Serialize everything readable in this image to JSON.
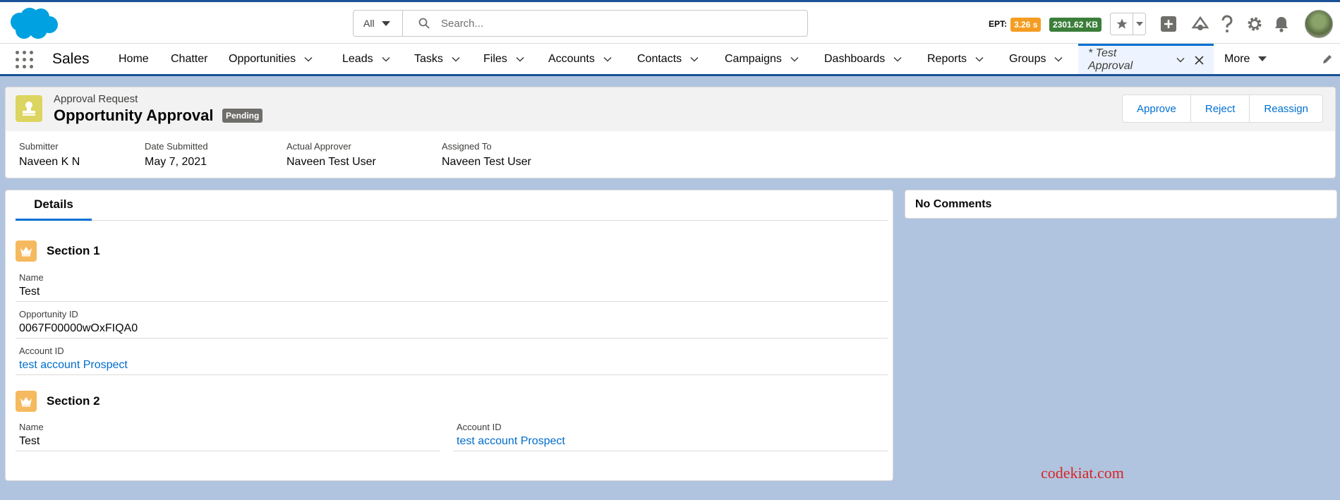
{
  "header": {
    "search": {
      "scope": "All",
      "placeholder": "Search..."
    },
    "ept": {
      "label": "EPT:",
      "time": "3.26 s",
      "size": "2301.62 KB"
    }
  },
  "nav": {
    "app_name": "Sales",
    "items": [
      {
        "label": "Home"
      },
      {
        "label": "Chatter"
      },
      {
        "label": "Opportunities"
      },
      {
        "label": "Leads"
      },
      {
        "label": "Tasks"
      },
      {
        "label": "Files"
      },
      {
        "label": "Accounts"
      },
      {
        "label": "Contacts"
      },
      {
        "label": "Campaigns"
      },
      {
        "label": "Dashboards"
      },
      {
        "label": "Reports"
      },
      {
        "label": "Groups"
      }
    ],
    "active_tab": "* Test Approval",
    "more": "More"
  },
  "record": {
    "kind": "Approval Request",
    "title": "Opportunity Approval",
    "status": "Pending",
    "actions": [
      "Approve",
      "Reject",
      "Reassign"
    ],
    "fields": [
      {
        "label": "Submitter",
        "value": "Naveen K N"
      },
      {
        "label": "Date Submitted",
        "value": "May 7, 2021"
      },
      {
        "label": "Actual Approver",
        "value": "Naveen Test User"
      },
      {
        "label": "Assigned To",
        "value": "Naveen Test User"
      }
    ]
  },
  "details": {
    "tab": "Details",
    "section1": {
      "title": "Section 1",
      "fields": [
        {
          "label": "Name",
          "value": "Test"
        },
        {
          "label": "Opportunity ID",
          "value": "0067F00000wOxFIQA0"
        },
        {
          "label": "Account ID",
          "value": "test account Prospect"
        }
      ]
    },
    "section2": {
      "title": "Section 2",
      "fields": [
        {
          "label": "Name",
          "value": "Test"
        },
        {
          "label": "Account ID",
          "value": "test account Prospect"
        }
      ]
    }
  },
  "comments": {
    "title": "No Comments"
  },
  "watermark": "codekiat.com",
  "colors": {
    "brand_blue": "#1b5297",
    "link_blue": "#006dcc",
    "ept_time": "#f49d22",
    "ept_size": "#3b7e3a",
    "approval_icon": "#dcd561",
    "section_icon": "#f5b960"
  }
}
